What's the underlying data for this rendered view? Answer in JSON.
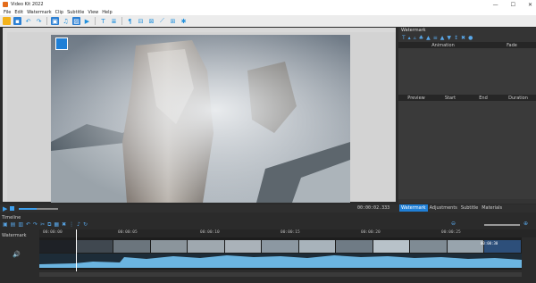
{
  "app": {
    "title": "Video Kit 2022"
  },
  "menu": [
    "File",
    "Edit",
    "Watermark",
    "Clip",
    "Subtitle",
    "View",
    "Help"
  ],
  "toolbar": {
    "icons": [
      "open-folder-icon",
      "save-icon",
      "undo-icon",
      "redo-icon",
      "image-icon",
      "music-icon",
      "photo-icon",
      "camera-icon",
      "text-icon",
      "subtitle-icon",
      "effects-icon"
    ]
  },
  "right_panel": {
    "title": "Watermark",
    "grid1_headers": [
      "Animation",
      "Fade"
    ],
    "grid2_headers": [
      "Preview",
      "Start",
      "End",
      "Duration"
    ]
  },
  "transport": {
    "timecode": "00:00:02.333",
    "tabs": [
      "Watermark",
      "Adjustments",
      "Subtitle",
      "Materials"
    ],
    "active_tab": "Watermark",
    "volume_level": 0.45
  },
  "timeline": {
    "label": "Timeline",
    "track_label": "Watermark",
    "ticks": [
      "00:00:00",
      "00:00:05",
      "00:00:10",
      "00:00:15",
      "00:00:20",
      "00:00:25"
    ],
    "clip_end_time": "00:00:30"
  },
  "colors": {
    "accent": "#1f7fd6",
    "panel": "#343434"
  }
}
